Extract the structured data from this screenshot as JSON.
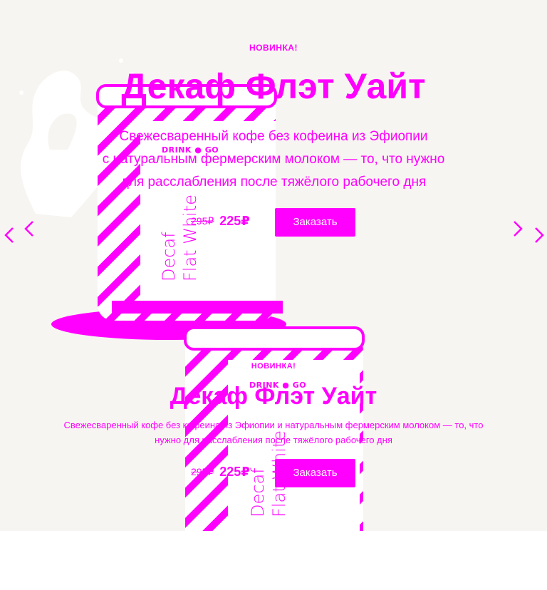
{
  "colors": {
    "accent": "#ff00ff",
    "background": "#f7f5f1",
    "white": "#ffffff"
  },
  "slide_desktop": {
    "badge": "НОВИНКА!",
    "title": "Декаф Флэт Уайт",
    "description_lines": [
      "Свежесваренный кофе без кофеина из Эфиопии",
      "с натуральным фермерским молоком — то, что нужно",
      "для расслабления после тяжёлого рабочего дня"
    ],
    "old_price": "295₽",
    "new_price": "225₽",
    "order_label": "Заказать"
  },
  "slide_mobile": {
    "badge": "НОВИНКА!",
    "title": "Декаф Флэт Уайт",
    "description_lines": [
      "Свежесваренный кофе без кофеина из Эфиопии и натуральным фермерским молоком — то, что",
      "нужно для расслабления после тяжёлого рабочего дня"
    ],
    "old_price": "295₽",
    "new_price": "225₽",
    "order_label": "Заказать"
  },
  "can": {
    "brand_left": "DRINK",
    "brand_right": "GO",
    "name_line1": "Decaf",
    "name_line2": "Flat White"
  },
  "navigation": {
    "prev_icon": "chevron-left-icon",
    "next_icon": "chevron-right-icon"
  }
}
